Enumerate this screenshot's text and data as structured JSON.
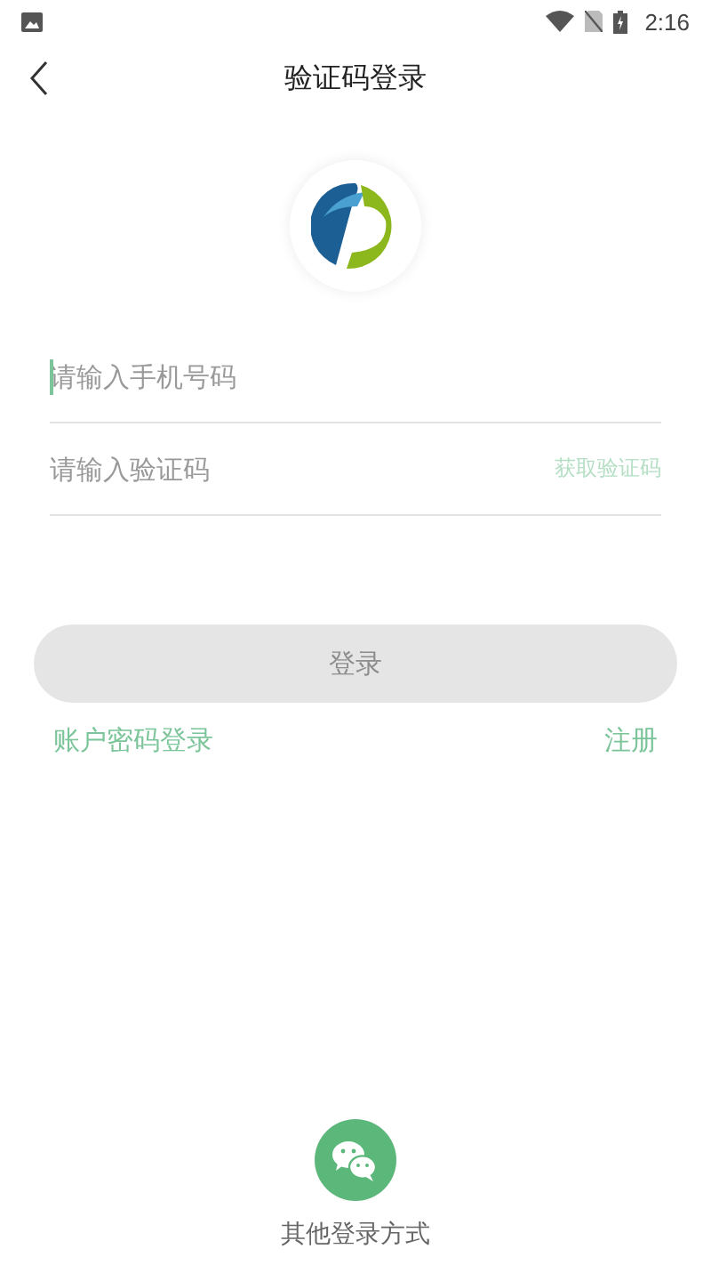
{
  "status_bar": {
    "time": "2:16"
  },
  "header": {
    "title": "验证码登录"
  },
  "form": {
    "phone": {
      "placeholder": "请输入手机号码",
      "focused": true
    },
    "code": {
      "placeholder": "请输入验证码"
    },
    "get_code_button": {
      "label": "获取验证码",
      "disabled": true
    },
    "login_button": {
      "label": "登录",
      "disabled": true
    },
    "links": [
      {
        "label": "账户密码登录"
      },
      {
        "label": "注册"
      }
    ]
  },
  "other_login": {
    "label": "其他登录方式"
  }
}
